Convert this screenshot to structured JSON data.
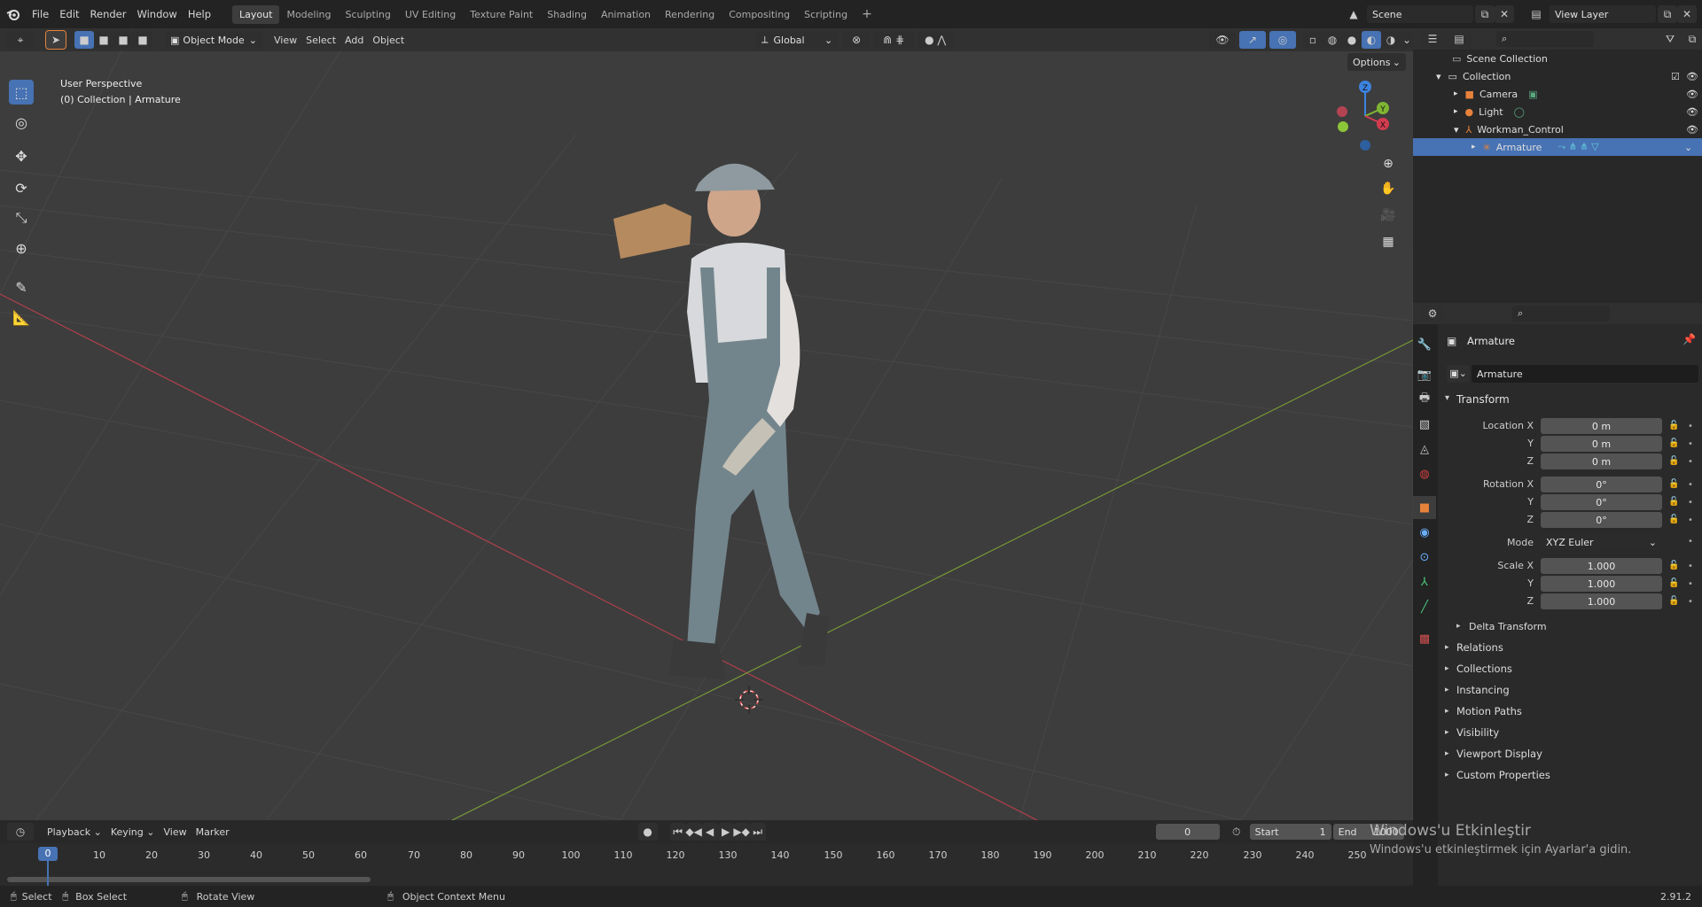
{
  "menu": {
    "logo_icon": "blender-logo-icon",
    "items": [
      "File",
      "Edit",
      "Render",
      "Window",
      "Help"
    ]
  },
  "workspaces": [
    "Layout",
    "Modeling",
    "Sculpting",
    "UV Editing",
    "Texture Paint",
    "Shading",
    "Animation",
    "Rendering",
    "Compositing",
    "Scripting"
  ],
  "add_workspace_label": "+",
  "scene": {
    "label": "Scene",
    "view_layer": "View Layer"
  },
  "viewport_header": {
    "mode": "Object Mode",
    "menus": [
      "View",
      "Select",
      "Add",
      "Object"
    ],
    "transform_orientation": "Global",
    "options_label": "Options"
  },
  "viewport_overlay": {
    "perspective": "User Perspective",
    "context": "(0) Collection | Armature"
  },
  "gizmo": {
    "x": "X",
    "y": "Y",
    "z": "Z"
  },
  "tools": [
    "select-box-icon",
    "cursor-icon",
    "move-icon",
    "rotate-icon",
    "scale-icon",
    "transform-icon",
    "annotate-icon",
    "measure-icon"
  ],
  "nav_buttons": [
    "zoom-icon",
    "hand-pan-icon",
    "camera-view-icon",
    "grid-ortho-icon"
  ],
  "outliner": {
    "rows": [
      {
        "label": "Scene Collection",
        "icon": "scene-collection-icon",
        "indent": 0
      },
      {
        "label": "Collection",
        "icon": "collection-icon",
        "indent": 1
      },
      {
        "label": "Camera",
        "icon": "camera-icon",
        "indent": 2
      },
      {
        "label": "Light",
        "icon": "light-icon",
        "indent": 2
      },
      {
        "label": "Workman_Control",
        "icon": "armature-object-icon",
        "indent": 2
      },
      {
        "label": "Armature",
        "icon": "armature-icon",
        "indent": 3,
        "selected": true
      }
    ]
  },
  "properties": {
    "object_name": "Armature",
    "object_field": "Armature",
    "transform_title": "Transform",
    "location": {
      "label": "Location X",
      "x": "0 m",
      "y": "0 m",
      "z": "0 m"
    },
    "rotation": {
      "label": "Rotation X",
      "x": "0°",
      "y": "0°",
      "z": "0°"
    },
    "mode": {
      "label": "Mode",
      "value": "XYZ Euler"
    },
    "scale": {
      "label": "Scale X",
      "x": "1.000",
      "y": "1.000",
      "z": "1.000"
    },
    "axis_y": "Y",
    "axis_z": "Z",
    "delta_transform": "Delta Transform",
    "panels": [
      "Relations",
      "Collections",
      "Instancing",
      "Motion Paths",
      "Visibility",
      "Viewport Display",
      "Custom Properties"
    ]
  },
  "timeline": {
    "menus": [
      "Playback",
      "Keying",
      "View",
      "Marker"
    ],
    "current_frame": "0",
    "start_label": "Start",
    "start": "1",
    "end_label": "End",
    "end": "1000",
    "ticks": [
      "0",
      "10",
      "20",
      "30",
      "40",
      "50",
      "60",
      "70",
      "80",
      "90",
      "100",
      "110",
      "120",
      "130",
      "140",
      "150",
      "160",
      "170",
      "180",
      "190",
      "200",
      "210",
      "220",
      "230",
      "240",
      "250"
    ],
    "playhead": "0"
  },
  "statusbar": {
    "select": "Select",
    "box_select": "Box Select",
    "rotate_view": "Rotate View",
    "context_menu": "Object Context Menu",
    "version": "2.91.2"
  },
  "watermark": {
    "title": "Windows'u Etkinleştir",
    "subtitle": "Windows'u etkinleştirmek için Ayarlar'a gidin."
  },
  "colors": {
    "accent": "#4772b3",
    "x_axis": "#d23c4f",
    "y_axis": "#7fb532",
    "z_axis": "#3c83e0",
    "object_orange": "#e8823b"
  }
}
